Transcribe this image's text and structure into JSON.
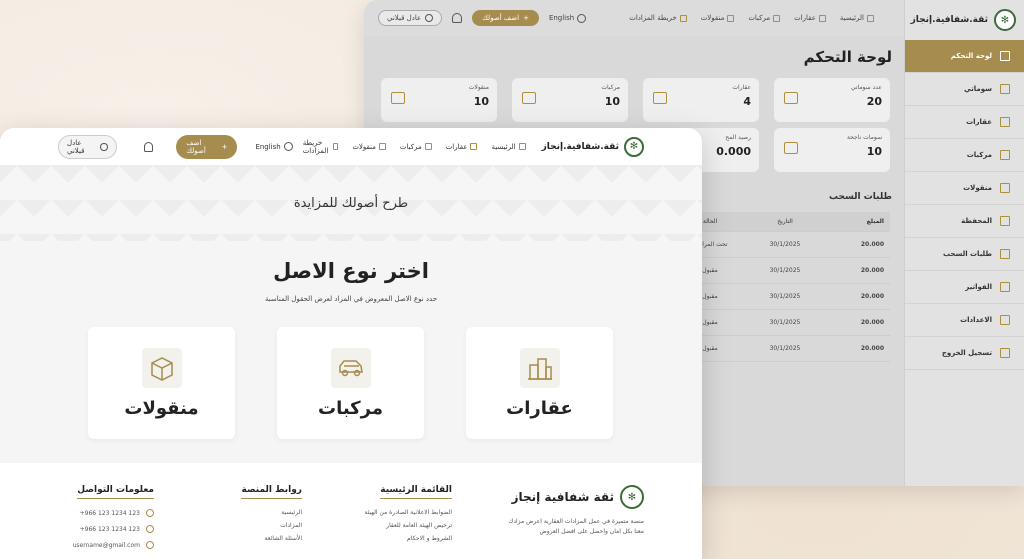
{
  "brand": {
    "name": "ثقة.شفافية.إنجاز",
    "name_footer": "ثقة شفافية إنجاز"
  },
  "dashboard": {
    "user": "عادل قيلاني",
    "add_asset": "اضف أصولك",
    "language": "English",
    "nav": [
      "الرئيسية",
      "عقارات",
      "مركبات",
      "منقولات",
      "خريطة المزادات"
    ],
    "title": "لوحة التحكم",
    "sidebar": [
      "لوحة التحكم",
      "سوماتي",
      "عقارات",
      "مركبات",
      "منقولات",
      "المحفظة",
      "طلبات السحب",
      "الفواتير",
      "الاعدادات",
      "تسجيل الخروج"
    ],
    "cards": [
      {
        "label": "عدد سوماتي",
        "value": "20"
      },
      {
        "label": "عقارات",
        "value": "4"
      },
      {
        "label": "مركبات",
        "value": "10"
      },
      {
        "label": "منقولات",
        "value": "10"
      },
      {
        "label": "سومات ناجحة",
        "value": "10"
      },
      {
        "label": "رصيد المح",
        "value": "0.000"
      }
    ],
    "withdrawals": {
      "title": "طلبات السحب",
      "headers": {
        "amount": "المبلغ",
        "date": "التاريخ",
        "status": "الحالة"
      },
      "rows": [
        {
          "amount": "20.000",
          "date": "30/1/2025",
          "status": "تحت المراجعة"
        },
        {
          "amount": "20.000",
          "date": "30/1/2025",
          "status": "مقبول"
        },
        {
          "amount": "20.000",
          "date": "30/1/2025",
          "status": "مقبول"
        },
        {
          "amount": "20.000",
          "date": "30/1/2025",
          "status": "مقبول"
        },
        {
          "amount": "20.000",
          "date": "30/1/2025",
          "status": "مقبول"
        }
      ]
    }
  },
  "auction": {
    "user": "عادل قيلاني",
    "add_asset": "اضف أصولك",
    "language": "English",
    "nav": [
      "الرئيسية",
      "عقارات",
      "مركبات",
      "منقولات",
      "خريطة المزادات"
    ],
    "hero_title": "طرح أصولك للمزايدة",
    "select_title": "اختر نوع الاصل",
    "select_sub": "حدد نوع الاصل المعروض في المزاد لعرض الحقول المناسبة",
    "asset_types": [
      "عقارات",
      "مركبات",
      "منقولات"
    ]
  },
  "footer": {
    "description": [
      "منصة متميزة في عمل المزادات العقارية اعرض مزادك",
      "معنا بكل امان واحصل على افضل العروض"
    ],
    "main_menu": {
      "title": "القائمة الرئيسية",
      "links": [
        "الضوابط الاعلانية الصادرة من الهيئة",
        "ترخيص الهيئة العامة للعقار",
        "الشروط و الاحكام"
      ]
    },
    "platform_links": {
      "title": "روابط المنصة",
      "links": [
        "الرئيسية",
        "المزادات",
        "الأسئلة الشائعة"
      ]
    },
    "contact": {
      "title": "معلومات التواصل",
      "phone1": "+966 123 1234 123",
      "phone2": "+966 123 1234 123",
      "email": "username@gmail.com"
    }
  },
  "colors": {
    "accent": "#a68d4f",
    "logo_green": "#3d6b3a"
  }
}
